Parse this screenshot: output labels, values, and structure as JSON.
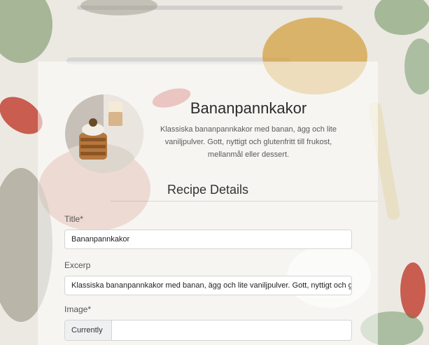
{
  "recipe": {
    "title": "Bananpannkakor",
    "description": "Klassiska bananpannkakor med banan, ägg och lite vaniljpulver. Gott, nyttigt och glutenfritt till frukost, mellanmål eller dessert."
  },
  "form": {
    "section_title": "Recipe Details",
    "title_label": "Title*",
    "title_value": "Bananpannkakor",
    "excerpt_label": "Excerp",
    "excerpt_value": "Klassiska bananpannkakor med banan, ägg och lite vaniljpulver. Gott, nyttigt och glutenfritt till frukost, mellanmål eller dessert.",
    "image_label": "Image*",
    "image_current_prefix": "Currently"
  },
  "colors": {
    "title": "#2b2b2b",
    "background": "#ece9e3",
    "spice_orange": "#d4a042",
    "chili_red": "#c0392b"
  }
}
